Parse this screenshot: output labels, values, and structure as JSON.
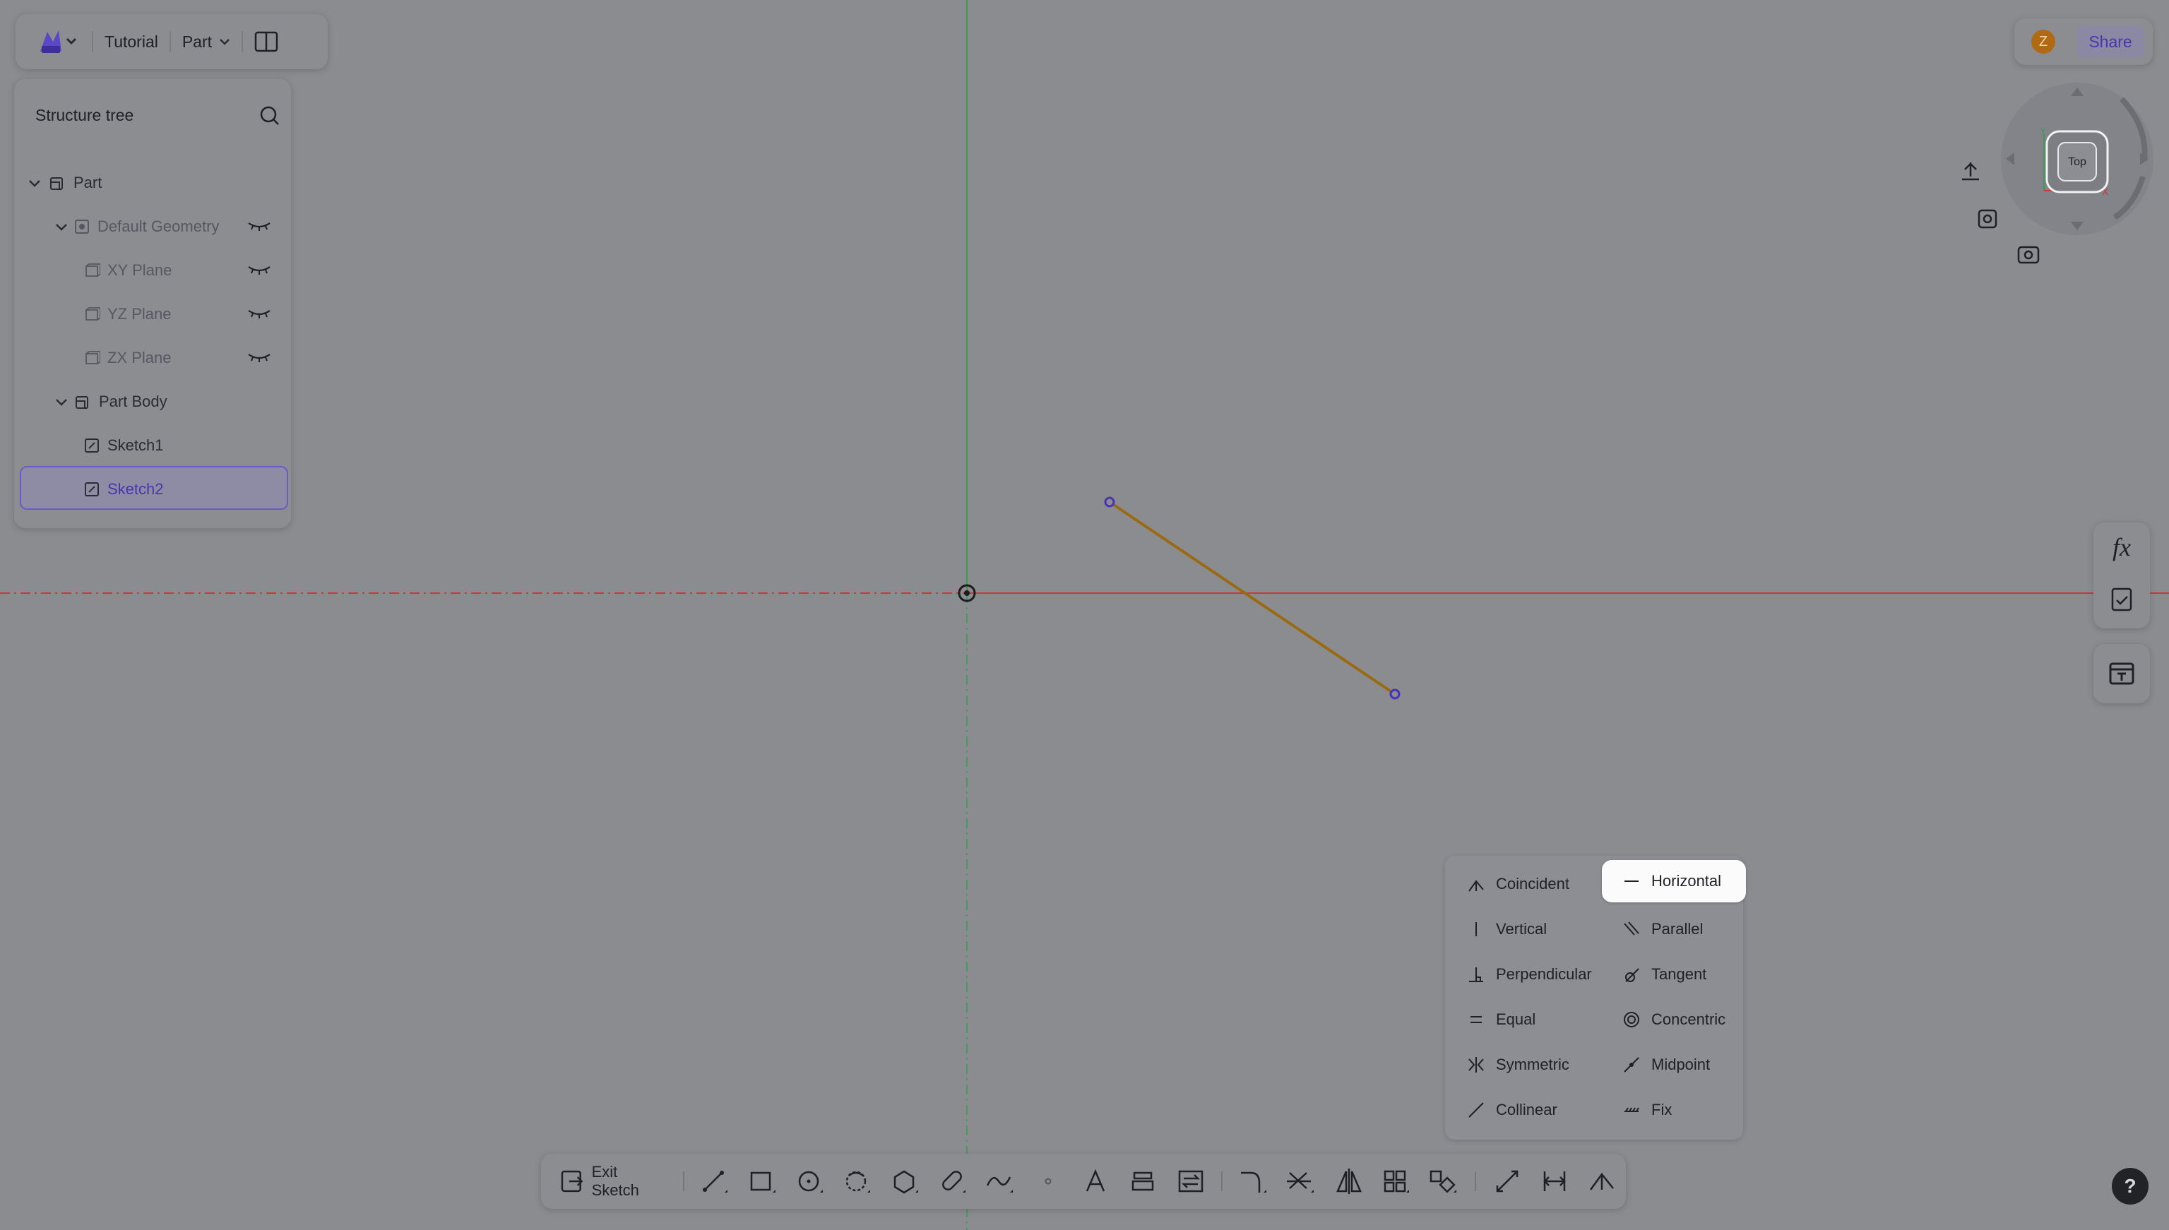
{
  "topbar": {
    "project": "Tutorial",
    "mode": "Part"
  },
  "tree": {
    "header": "Structure tree",
    "items": [
      {
        "label": "Part"
      },
      {
        "label": "Default Geometry"
      },
      {
        "label": "XY Plane"
      },
      {
        "label": "YZ Plane"
      },
      {
        "label": "ZX Plane"
      },
      {
        "label": "Part Body"
      },
      {
        "label": "Sketch1"
      },
      {
        "label": "Sketch2"
      }
    ]
  },
  "header_right": {
    "avatar_initial": "Z",
    "share_label": "Share"
  },
  "viewcube": {
    "face": "Top",
    "axis_x": "X",
    "axis_y": "Y"
  },
  "side": {
    "fx_label": "fx"
  },
  "constraints": {
    "items": [
      {
        "label": "Coincident",
        "icon": "coincident-icon"
      },
      {
        "label": "Horizontal",
        "icon": "horizontal-icon"
      },
      {
        "label": "Vertical",
        "icon": "vertical-icon"
      },
      {
        "label": "Parallel",
        "icon": "parallel-icon"
      },
      {
        "label": "Perpendicular",
        "icon": "perpendicular-icon"
      },
      {
        "label": "Tangent",
        "icon": "tangent-icon"
      },
      {
        "label": "Equal",
        "icon": "equal-icon"
      },
      {
        "label": "Concentric",
        "icon": "concentric-icon"
      },
      {
        "label": "Symmetric",
        "icon": "symmetric-icon"
      },
      {
        "label": "Midpoint",
        "icon": "midpoint-icon"
      },
      {
        "label": "Collinear",
        "icon": "collinear-icon"
      },
      {
        "label": "Fix",
        "icon": "fix-icon"
      }
    ],
    "highlighted": "Horizontal"
  },
  "toolbar": {
    "exit_label": "Exit Sketch",
    "help_label": "?"
  },
  "colors": {
    "accent": "#4637b0",
    "line": "#9a6a12",
    "x_axis": "#c8393f",
    "y_axis": "#3d9a55"
  }
}
